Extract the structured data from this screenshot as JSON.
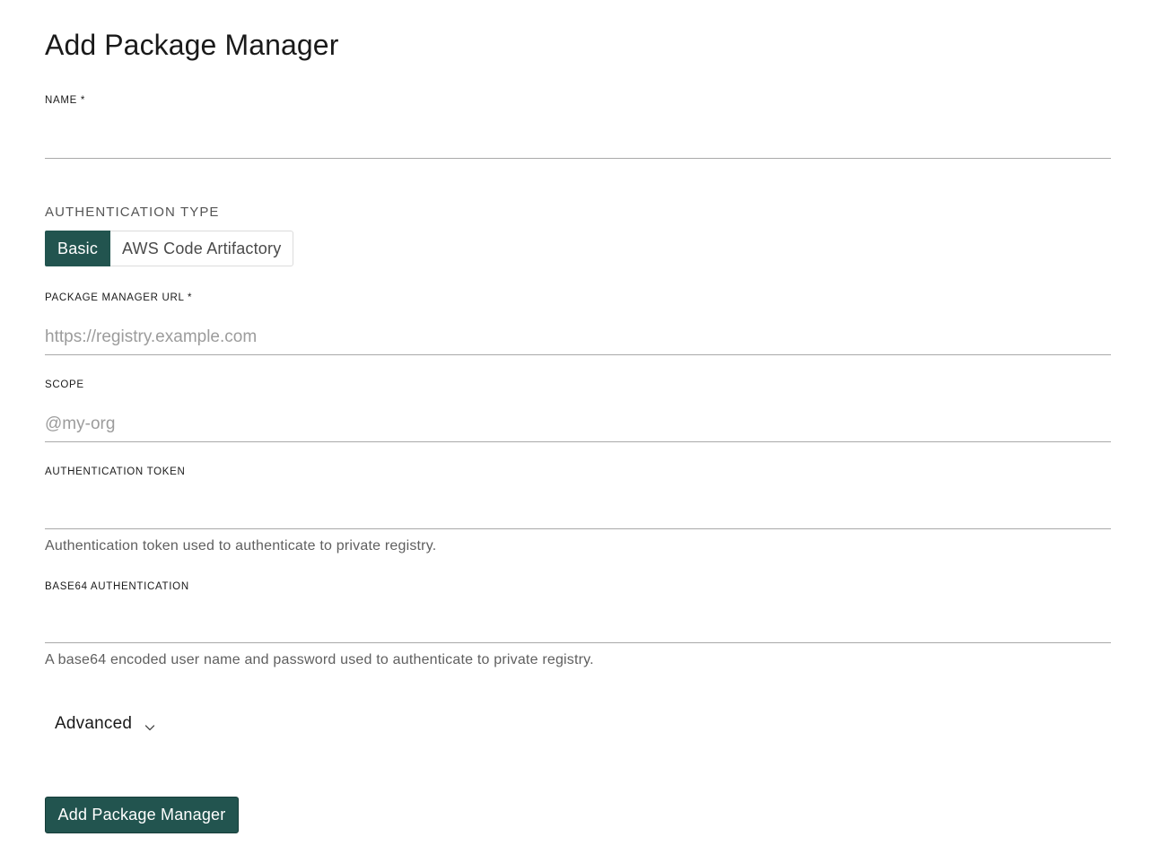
{
  "page": {
    "title": "Add Package Manager"
  },
  "form": {
    "name": {
      "label": "NAME *",
      "value": "",
      "placeholder": ""
    },
    "auth_type": {
      "label": "AUTHENTICATION TYPE",
      "options": [
        "Basic",
        "AWS Code Artifactory"
      ],
      "selected": "Basic"
    },
    "url": {
      "label": "PACKAGE MANAGER URL *",
      "value": "",
      "placeholder": "https://registry.example.com"
    },
    "scope": {
      "label": "SCOPE",
      "value": "",
      "placeholder": "@my-org"
    },
    "auth_token": {
      "label": "AUTHENTICATION TOKEN",
      "value": "",
      "placeholder": "",
      "helper": "Authentication token used to authenticate to private registry."
    },
    "base64_auth": {
      "label": "BASE64 AUTHENTICATION",
      "value": "",
      "placeholder": "",
      "helper": "A base64 encoded user name and password used to authenticate to private registry."
    },
    "advanced": {
      "label": "Advanced",
      "icon": "chevron-down-icon"
    },
    "submit_label": "Add Package Manager"
  },
  "colors": {
    "accent": "#22544f",
    "border": "#a9a9a9",
    "placeholder": "#9c9c9c"
  }
}
